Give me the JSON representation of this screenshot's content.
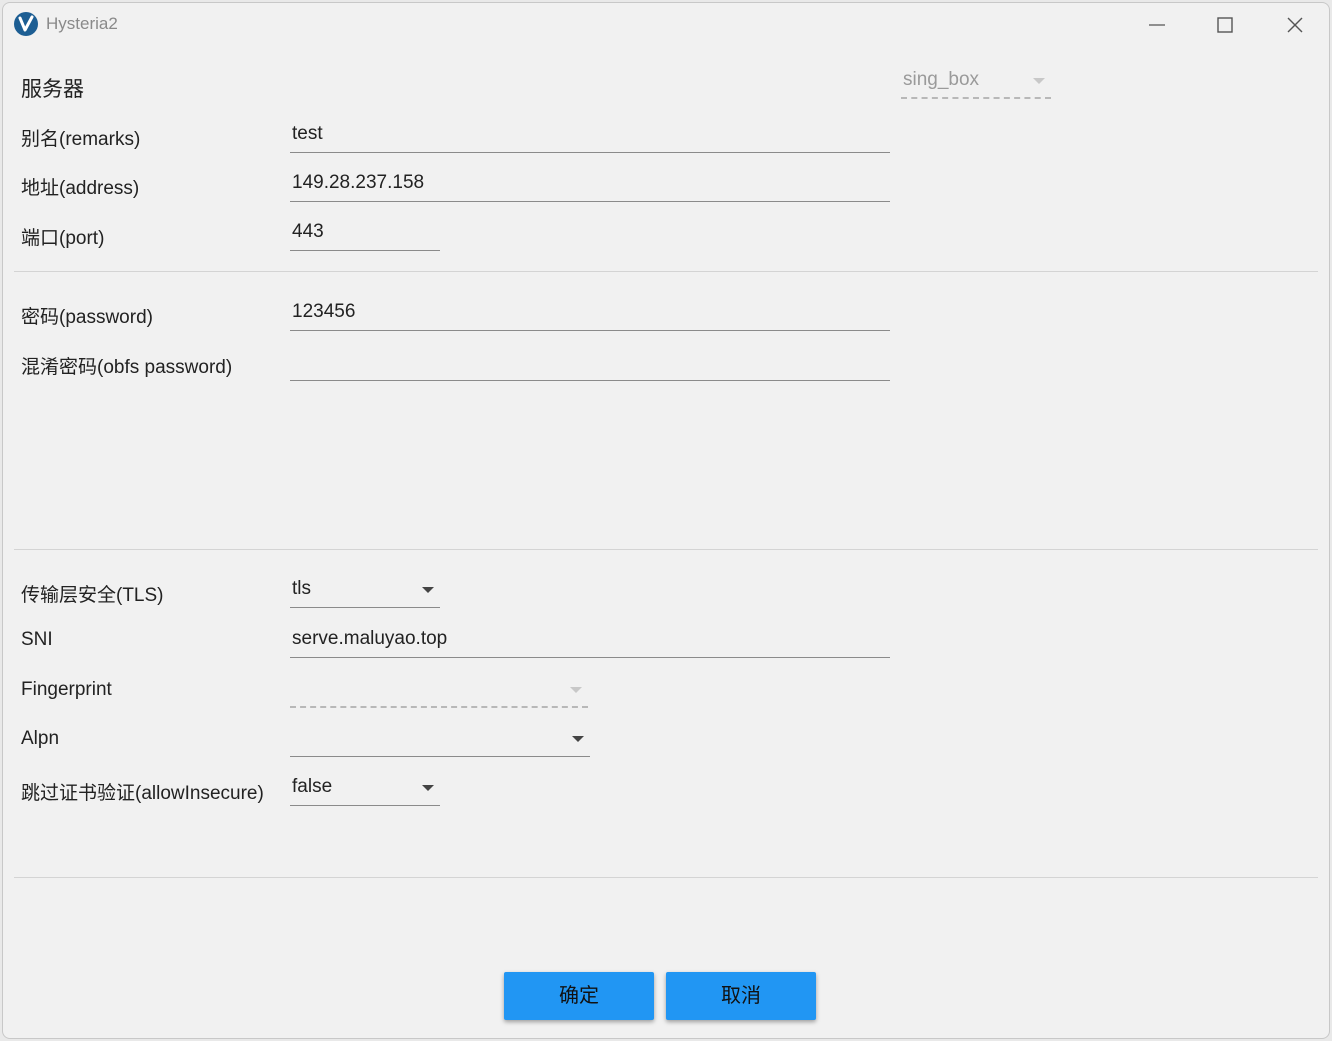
{
  "window": {
    "title": "Hysteria2"
  },
  "header": {
    "section_label": "服务器",
    "core_type": "sing_box"
  },
  "fields": {
    "remarks": {
      "label": "别名(remarks)",
      "value": "test"
    },
    "address": {
      "label": "地址(address)",
      "value": "149.28.237.158"
    },
    "port": {
      "label": "端口(port)",
      "value": "443"
    },
    "password": {
      "label": "密码(password)",
      "value": "123456"
    },
    "obfs_password": {
      "label": "混淆密码(obfs password)",
      "value": ""
    },
    "tls": {
      "label": "传输层安全(TLS)",
      "value": "tls"
    },
    "sni": {
      "label": "SNI",
      "value": "serve.maluyao.top"
    },
    "fingerprint": {
      "label": "Fingerprint",
      "value": ""
    },
    "alpn": {
      "label": "Alpn",
      "value": ""
    },
    "allow_insecure": {
      "label": "跳过证书验证(allowInsecure)",
      "value": "false"
    }
  },
  "buttons": {
    "ok": "确定",
    "cancel": "取消"
  },
  "colors": {
    "accent": "#2196f3",
    "icon": "#1d5e93"
  }
}
